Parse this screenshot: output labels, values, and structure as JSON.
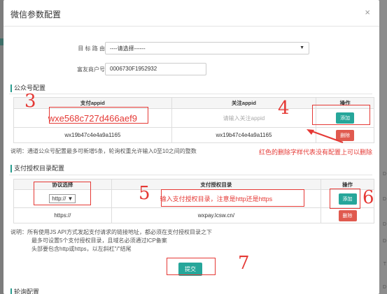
{
  "modal": {
    "title": "微信参数配置",
    "close": "×"
  },
  "form": {
    "route_label": "目 标 路 由",
    "route_value": "----请选择------",
    "merchant_label": "富友商户号",
    "merchant_value": "0006730F1952932"
  },
  "official": {
    "section_title": "公众号配置",
    "headers": [
      "支付appid",
      "关注appid",
      "操作"
    ],
    "input_appid": "wxe568c727d466aef9",
    "input_follow_placeholder": "请输入关注appid",
    "add": "添加",
    "row": {
      "appid": "wx19b47c4e4a9a1165",
      "follow": "wx19b47c4e4a9a1165",
      "del": "删除"
    },
    "note": "说明：通道公众号配置最多可新增5条，轮询权重允许输入0至10之间的整数"
  },
  "auth": {
    "section_title": "支付授权目录配置",
    "headers": [
      "协议选择",
      "支付授权目录",
      "操作"
    ],
    "protocol_value": "http://",
    "dir_placeholder": "输入支付授权目录，注意是http还是https",
    "add": "添加",
    "row": {
      "protocol": "https://",
      "dir": "wxpay.lcsw.cn/",
      "del": "删除"
    },
    "notes": [
      "说明：所有使用JS API方式发起支付请求的链接地址，都必须在支付授权目录之下",
      "最多可设置5个支付授权目录，且域名必须通过ICP备案",
      "头部要包含http或https，以左斜杠\"/\"结尾"
    ],
    "submit": "提交"
  },
  "next_section_title": "轮询配置",
  "annotations": {
    "n3": "3",
    "n4": "4",
    "n5": "5",
    "n6": "6",
    "n7": "7",
    "delete_hint": "红色的删除字样代表没有配置上可以删除"
  },
  "side_letters": [
    "D",
    "D",
    "D",
    "D",
    "T",
    "D"
  ],
  "colors": {
    "accent": "#26a69a",
    "danger": "#e05a4f",
    "annotation": "#e53935"
  }
}
